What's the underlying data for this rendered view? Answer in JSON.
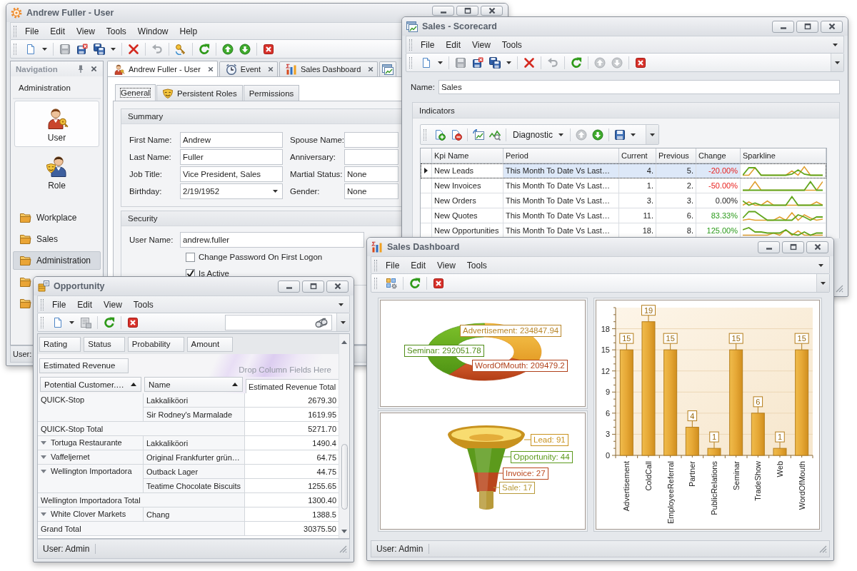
{
  "windows": {
    "user": {
      "title": "Andrew Fuller - User",
      "menu": [
        "File",
        "Edit",
        "View",
        "Tools",
        "Window",
        "Help"
      ],
      "navigation": {
        "title": "Navigation",
        "group": "Administration",
        "large_items": [
          {
            "label": "User",
            "selected": true
          },
          {
            "label": "Role",
            "selected": false
          }
        ],
        "items": [
          {
            "label": "Workplace",
            "selected": false
          },
          {
            "label": "Sales",
            "selected": false
          },
          {
            "label": "Administration",
            "selected": true
          },
          {
            "selected": false
          },
          {
            "selected": false
          }
        ]
      },
      "tabs": [
        {
          "label": "Andrew Fuller - User",
          "selected": true
        },
        {
          "label": "Event",
          "selected": false
        },
        {
          "label": "Sales Dashboard",
          "selected": false
        },
        {
          "selected": false
        }
      ],
      "detail_tabs": [
        {
          "label": "General",
          "selected": true
        },
        {
          "label": "Persistent Roles",
          "selected": false
        },
        {
          "label": "Permissions",
          "selected": false
        }
      ],
      "summary": {
        "title": "Summary",
        "fields": [
          {
            "label": "First Name:",
            "value": "Andrew",
            "kind": "text"
          },
          {
            "label": "Spouse Name:",
            "kind": "text"
          },
          {
            "label": "Last Name:",
            "value": "Fuller",
            "kind": "text"
          },
          {
            "label": "Anniversary:",
            "kind": "text"
          },
          {
            "label": "Job Title:",
            "value": "Vice President, Sales",
            "kind": "text"
          },
          {
            "label": "Martial Status:",
            "value": "None",
            "kind": "text"
          },
          {
            "label": "Birthday:",
            "value": "2/19/1952",
            "kind": "date"
          },
          {
            "label": "Gender:",
            "value": "None",
            "kind": "text"
          }
        ]
      },
      "security": {
        "title": "Security",
        "fields": [
          {
            "label": "User Name:",
            "value": "andrew.fuller",
            "kind": "text"
          }
        ],
        "checkboxes": [
          {
            "label": "Change Password On First Logon",
            "checked": false
          },
          {
            "label": "Is Active",
            "checked": true
          }
        ]
      },
      "status": "User:"
    },
    "scorecard": {
      "title": "Sales - Scorecard",
      "menu": [
        "File",
        "Edit",
        "View",
        "Tools"
      ],
      "name": {
        "label": "Name:",
        "value": "Sales"
      },
      "indicators": {
        "title": "Indicators",
        "view": "Diagnostic",
        "columns": [
          "Kpi Name",
          "Period",
          "Current",
          "Previous",
          "Change",
          "Sparkline"
        ],
        "rows": [
          {
            "kpi_name": "New Leads",
            "period": "This Month To Date Vs Last…",
            "current": "4.",
            "previous": "5.",
            "change": "-20.00%",
            "negative": true,
            "positive": false,
            "selected": true
          },
          {
            "kpi_name": "New Invoices",
            "period": "This Month To Date Vs Last…",
            "current": "1.",
            "previous": "2.",
            "change": "-50.00%",
            "negative": true,
            "positive": false,
            "selected": false
          },
          {
            "kpi_name": "New Orders",
            "period": "This Month To Date Vs Last…",
            "current": "3.",
            "previous": "3.",
            "change": "0.00%",
            "negative": false,
            "positive": false,
            "selected": false
          },
          {
            "kpi_name": "New Quotes",
            "period": "This Month To Date Vs Last…",
            "current": "11.",
            "previous": "6.",
            "change": "83.33%",
            "negative": false,
            "positive": true,
            "selected": false
          },
          {
            "kpi_name": "New Opportunities",
            "period": "This Month To Date Vs Last…",
            "current": "18.",
            "previous": "8.",
            "change": "125.00%",
            "negative": false,
            "positive": true,
            "selected": false
          }
        ]
      }
    },
    "opportunity": {
      "title": "Opportunity",
      "menu": [
        "File",
        "Edit",
        "View",
        "Tools"
      ],
      "filter_fields": [
        "Rating",
        "Status",
        "Probability",
        "Amount"
      ],
      "data_fields": [
        "Estimated Revenue"
      ],
      "column_area": {
        "placeholder": "Drop Column Fields Here"
      },
      "row_fields": [
        {
          "label": "Potential Customer.…",
          "sorted": true
        },
        {
          "label": "Name",
          "sorted": true
        }
      ],
      "value_header": "Estimated Revenue Total",
      "groups": [
        {
          "customer": "QUICK-Stop",
          "expander": false,
          "items": [
            {
              "name": "Lakkaliköori",
              "value": "2679.30"
            },
            {
              "name": "Sir Rodney's Marmalade",
              "value": "1619.95"
            }
          ],
          "total": {
            "label": "QUICK-Stop Total",
            "value": "5271.70"
          }
        },
        {
          "customer": "Tortuga Restaurante",
          "expander": true,
          "items": [
            {
              "name": "Lakkaliköori",
              "value": "1490.4"
            }
          ]
        },
        {
          "customer": "Vaffeljernet",
          "expander": true,
          "items": [
            {
              "name": "Original Frankfurter grün…",
              "value": "64.75"
            }
          ]
        },
        {
          "customer": "Wellington Importadora",
          "expander": true,
          "items": [
            {
              "name": "Outback Lager",
              "value": "44.75"
            },
            {
              "name": "Teatime Chocolate Biscuits",
              "value": "1255.65"
            }
          ],
          "total": {
            "label": "Wellington Importadora Total",
            "value": "1300.40"
          }
        },
        {
          "customer": "White Clover Markets",
          "expander": true,
          "items": [
            {
              "name": "Chang",
              "value": "1388.5"
            }
          ]
        }
      ],
      "grand_total": {
        "label": "Grand Total",
        "value": "30375.50"
      },
      "status": "User: Admin"
    },
    "dashboard": {
      "title": "Sales Dashboard",
      "menu": [
        "File",
        "Edit",
        "View",
        "Tools"
      ],
      "revenue_chart": {
        "chart_data": {
          "type": "donut",
          "values": [
            234847.94,
            292051.78,
            209479.2
          ],
          "value_labels": [
            "Advertisement: 234847.94",
            "Seminar: 292051.78",
            "WordOfMouth: 209479.2"
          ]
        }
      },
      "funnel": {
        "stages": [
          {
            "label": "Lead: 91",
            "color": "#c8921e"
          },
          {
            "label": "Opportunity: 44",
            "color": "#5c9a1c"
          },
          {
            "label": "Invoice: 27",
            "color": "#b9461c"
          },
          {
            "label": "Sale: 17",
            "color": "#b89a3a"
          }
        ]
      },
      "source_chart": {
        "chart_data": {
          "type": "bar",
          "categories": [
            "Advertisement",
            "ColdCall",
            "EmployeeReferral",
            "Partner",
            "PublicRelations",
            "Seminar",
            "TradeShow",
            "Web",
            "WordOfMouth"
          ],
          "values": [
            15,
            19,
            15,
            4,
            1,
            15,
            6,
            1,
            15
          ],
          "ylim": [
            0,
            21
          ],
          "yticks": [
            0,
            3,
            6,
            9,
            12,
            15,
            18
          ],
          "grid": true,
          "data_labels": true
        }
      },
      "status": "User: Admin"
    }
  }
}
